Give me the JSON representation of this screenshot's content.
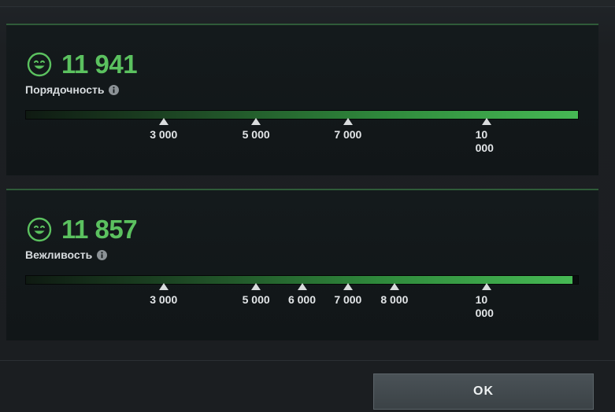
{
  "dialog": {
    "metrics": [
      {
        "score": "11 941",
        "label": "Порядочность",
        "progress_fraction": 1.0,
        "markers": [
          {
            "value": 3000,
            "label": "3 000",
            "position": 0.25
          },
          {
            "value": 5000,
            "label": "5 000",
            "position": 0.417
          },
          {
            "value": 7000,
            "label": "7 000",
            "position": 0.583
          },
          {
            "value": 10000,
            "label": "10 000",
            "position": 0.833
          }
        ]
      },
      {
        "score": "11 857",
        "label": "Вежливость",
        "progress_fraction": 0.99,
        "markers": [
          {
            "value": 3000,
            "label": "3 000",
            "position": 0.25
          },
          {
            "value": 5000,
            "label": "5 000",
            "position": 0.417
          },
          {
            "value": 6000,
            "label": "6 000",
            "position": 0.5
          },
          {
            "value": 7000,
            "label": "7 000",
            "position": 0.583
          },
          {
            "value": 8000,
            "label": "8 000",
            "position": 0.667
          },
          {
            "value": 10000,
            "label": "10 000",
            "position": 0.833
          }
        ]
      }
    ],
    "ok_label": "OK"
  },
  "colors": {
    "accent_green": "#5bc15f",
    "bar_green": "#46b954",
    "panel_border": "#2f5b39",
    "background": "#1b1e21"
  },
  "icons": {
    "score_icon": "smiley-face-icon",
    "info_icon": "info-icon"
  }
}
